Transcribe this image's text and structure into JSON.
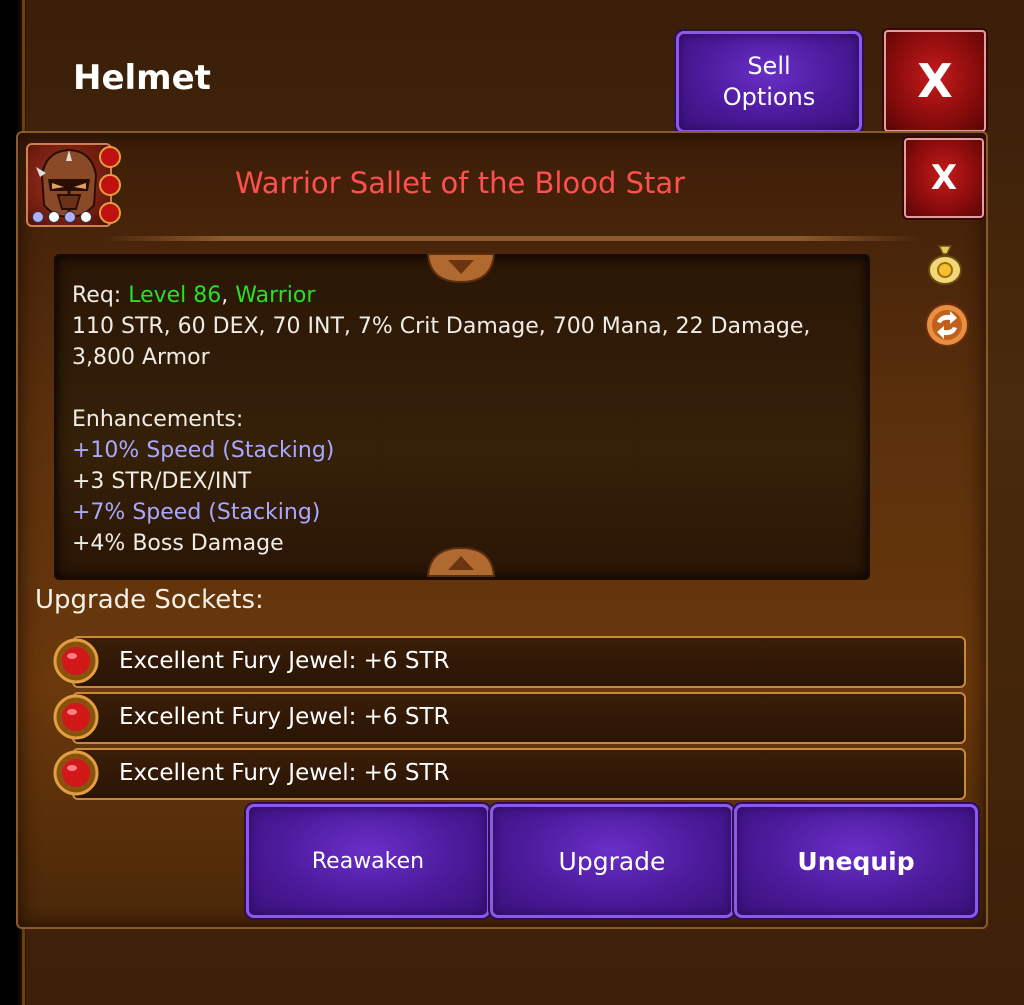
{
  "header": {
    "title": "Helmet",
    "sell_options_line1": "Sell",
    "sell_options_line2": "Options",
    "close_label": "X"
  },
  "item": {
    "name": "Warrior Sallet of the Blood Star",
    "close_label": "X",
    "name_color": "#ff4f4f",
    "req_label": "Req: ",
    "req_level": "Level 86",
    "req_sep": ", ",
    "req_class": "Warrior",
    "stats": "110 STR, 60 DEX, 70 INT, 7% Crit Damage, 700 Mana, 22 Damage, 3,800 Armor",
    "enhancements_title": "Enhancements:",
    "enhancements": [
      {
        "text": "+10% Speed (Stacking)",
        "color": "blue"
      },
      {
        "text": "+3 STR/DEX/INT",
        "color": "white"
      },
      {
        "text": "+7% Speed (Stacking)",
        "color": "blue"
      },
      {
        "text": "+4% Boss Damage",
        "color": "white"
      }
    ]
  },
  "sockets": {
    "title": "Upgrade Sockets:",
    "items": [
      {
        "label": "Excellent Fury Jewel: +6 STR",
        "icon": "red-jewel-icon"
      },
      {
        "label": "Excellent Fury Jewel: +6 STR",
        "icon": "red-jewel-icon"
      },
      {
        "label": "Excellent Fury Jewel: +6 STR",
        "icon": "red-jewel-icon"
      }
    ]
  },
  "actions": {
    "reawaken": "Reawaken",
    "upgrade": "Upgrade",
    "unequip": "Unequip"
  },
  "side_icons": [
    "gold-bag-icon",
    "swap-icon"
  ],
  "colors": {
    "accent_purple": "#4b1a9a",
    "close_red": "#a31212",
    "req_green": "#27e027",
    "enhance_blue": "#a8a8ff"
  }
}
